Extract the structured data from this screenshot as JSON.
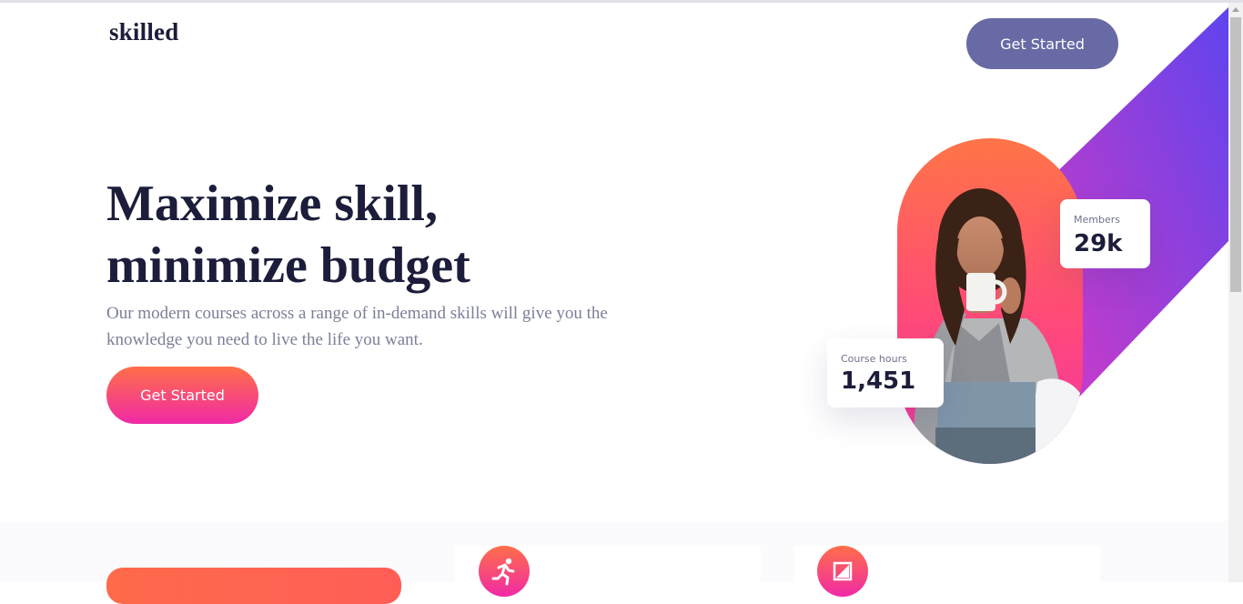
{
  "header": {
    "logo": "skilled",
    "cta_label": "Get Started"
  },
  "hero": {
    "title_line1": "Maximize skill,",
    "title_line2": "minimize budget",
    "subtitle": "Our modern courses across a range of in-demand skills will give you the knowledge you need to live the life you want.",
    "cta_label": "Get Started"
  },
  "stats": {
    "members": {
      "label": "Members",
      "value": "29k"
    },
    "course_hours": {
      "label": "Course hours",
      "value": "1,451"
    }
  },
  "features": {
    "icons": [
      "running-person-icon",
      "image-frame-icon"
    ]
  },
  "colors": {
    "text_dark": "#1b1d3a",
    "header_button": "#676aa4",
    "gradient_orange": "#ff6f48",
    "gradient_pink": "#f02aa6",
    "diagonal_purple": "#6b3fe8",
    "diagonal_magenta": "#c737cc"
  }
}
